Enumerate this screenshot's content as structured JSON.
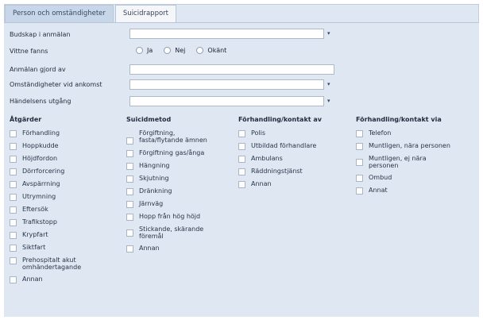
{
  "tabs": [
    {
      "label": "Person och omständigheter"
    },
    {
      "label": "Suicidrapport"
    }
  ],
  "form": {
    "budskap_label": "Budskap i anmälan",
    "vittne_label": "Vittne fanns",
    "vittne_options": [
      "Ja",
      "Nej",
      "Okänt"
    ],
    "anmalan_label": "Anmälan gjord av",
    "omstandigheter_label": "Omständigheter vid ankomst",
    "handelse_label": "Händelsens utgång",
    "dropdown_arrow": "▾"
  },
  "columns": [
    {
      "heading": "Åtgärder",
      "items": [
        "Förhandling",
        "Hoppkudde",
        "Höjdfordon",
        "Dörrforcering",
        "Avspärrning",
        "Utrymning",
        "Eftersök",
        "Trafikstopp",
        "Krypfart",
        "Siktfart",
        "Prehospitalt akut omhändertagande",
        "Annan"
      ]
    },
    {
      "heading": "Suicidmetod",
      "items": [
        "Förgiftning, fasta/flytande ämnen",
        "Förgiftning gas/ånga",
        "Hängning",
        "Skjutning",
        "Dränkning",
        "Järnväg",
        "Hopp från hög höjd",
        "Stickande, skärande föremål",
        "Annan"
      ]
    },
    {
      "heading": "Förhandling/kontakt av",
      "items": [
        "Polis",
        "Utbildad förhandlare",
        "Ambulans",
        "Räddningstjänst",
        "Annan"
      ]
    },
    {
      "heading": "Förhandling/kontakt via",
      "items": [
        "Telefon",
        "Muntligen, nära personen",
        "Muntligen, ej nära personen",
        "Ombud",
        "Annat"
      ]
    }
  ]
}
